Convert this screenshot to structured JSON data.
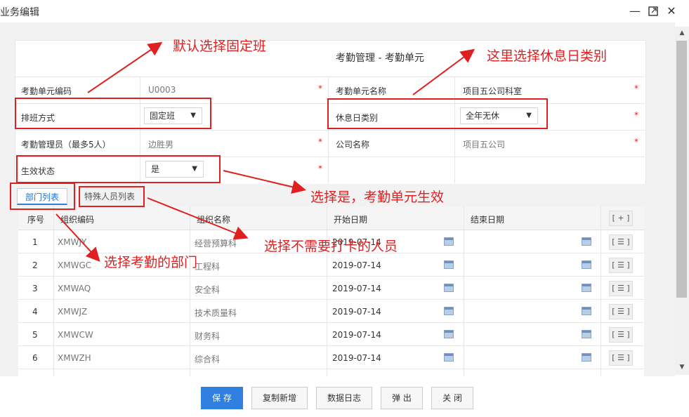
{
  "window": {
    "title": "业务编辑"
  },
  "form": {
    "title": "考勤管理 - 考勤单元",
    "unit_code": {
      "label": "考勤单元编码",
      "value": "U0003"
    },
    "unit_name": {
      "label": "考勤单元名称",
      "value": "项目五公司科室"
    },
    "schedule_mode": {
      "label": "排班方式",
      "value": "固定班"
    },
    "rest_day_type": {
      "label": "休息日类别",
      "value": "全年无休"
    },
    "admin": {
      "label": "考勤管理员（最多5人）",
      "value": "边胜男"
    },
    "company": {
      "label": "公司名称",
      "value": "项目五公司"
    },
    "status": {
      "label": "生效状态",
      "value": "是"
    },
    "required_mark": "*"
  },
  "tabs": [
    {
      "label": "部门列表",
      "active": true
    },
    {
      "label": "特殊人员列表",
      "active": false
    }
  ],
  "grid": {
    "headers": [
      "序号",
      "组织编码",
      "组织名称",
      "开始日期",
      "结束日期"
    ],
    "add_button": "[ + ]",
    "row_button": "[ ☰ ]",
    "rows": [
      [
        "1",
        "XMWJY",
        "经营预算科",
        "2019-07-14",
        ""
      ],
      [
        "2",
        "XMWGC",
        "工程科",
        "2019-07-14",
        ""
      ],
      [
        "3",
        "XMWAQ",
        "安全科",
        "2019-07-14",
        ""
      ],
      [
        "4",
        "XMWJZ",
        "技术质量科",
        "2019-07-14",
        ""
      ],
      [
        "5",
        "XMWCW",
        "财务科",
        "2019-07-14",
        ""
      ],
      [
        "6",
        "XMWZH",
        "综合科",
        "2019-07-14",
        ""
      ]
    ]
  },
  "footer": {
    "save": "保 存",
    "copy_new": "复制新增",
    "data_log": "数据日志",
    "popout": "弹 出",
    "close": "关 闭"
  },
  "annotations": {
    "default_fixed": "默认选择固定班",
    "rest_day": "这里选择休息日类别",
    "status_yes": "选择是，考勤单元生效",
    "dept": "选择考勤的部门",
    "special": "选择不需要打卡的人员"
  },
  "colors": {
    "accent": "#2f80e0",
    "annotation": "#e02020"
  },
  "icons": {
    "minimize": "minimize-icon",
    "maximize": "maximize-icon",
    "close": "close-icon",
    "calendar": "calendar-icon"
  }
}
